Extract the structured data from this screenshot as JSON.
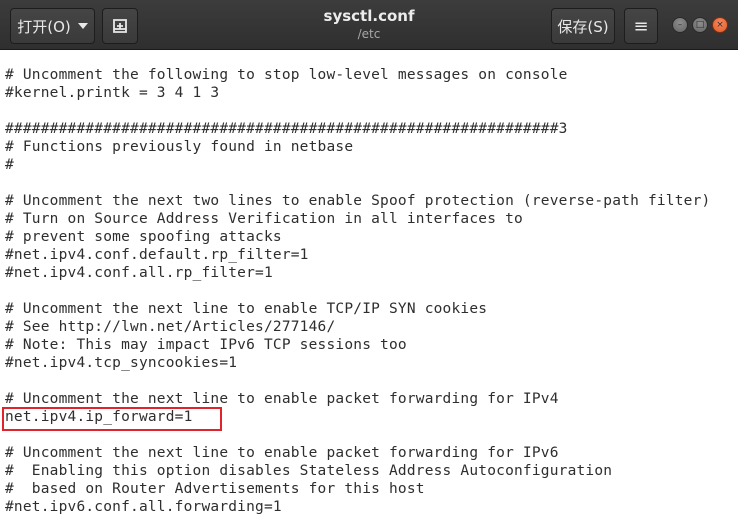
{
  "header": {
    "open_label": "打开(O)",
    "save_label": "保存(S)",
    "title": "sysctl.conf",
    "subtitle": "/etc",
    "new_document_icon": "new-document-icon",
    "menu_icon": "hamburger-menu-icon",
    "menu_glyph": "≡"
  },
  "window_controls": {
    "minimize_glyph": "–",
    "maximize_glyph": "□",
    "close_glyph": "×"
  },
  "editor": {
    "highlighted_line_index": 19,
    "highlight_color": "#e0242b",
    "lines": [
      "# Uncomment the following to stop low-level messages on console",
      "#kernel.printk = 3 4 1 3",
      "",
      "##############################################################3",
      "# Functions previously found in netbase",
      "#",
      "",
      "# Uncomment the next two lines to enable Spoof protection (reverse-path filter)",
      "# Turn on Source Address Verification in all interfaces to",
      "# prevent some spoofing attacks",
      "#net.ipv4.conf.default.rp_filter=1",
      "#net.ipv4.conf.all.rp_filter=1",
      "",
      "# Uncomment the next line to enable TCP/IP SYN cookies",
      "# See http://lwn.net/Articles/277146/",
      "# Note: This may impact IPv6 TCP sessions too",
      "#net.ipv4.tcp_syncookies=1",
      "",
      "# Uncomment the next line to enable packet forwarding for IPv4",
      "net.ipv4.ip_forward=1",
      "",
      "# Uncomment the next line to enable packet forwarding for IPv6",
      "#  Enabling this option disables Stateless Address Autoconfiguration",
      "#  based on Router Advertisements for this host",
      "#net.ipv6.conf.all.forwarding=1"
    ]
  }
}
